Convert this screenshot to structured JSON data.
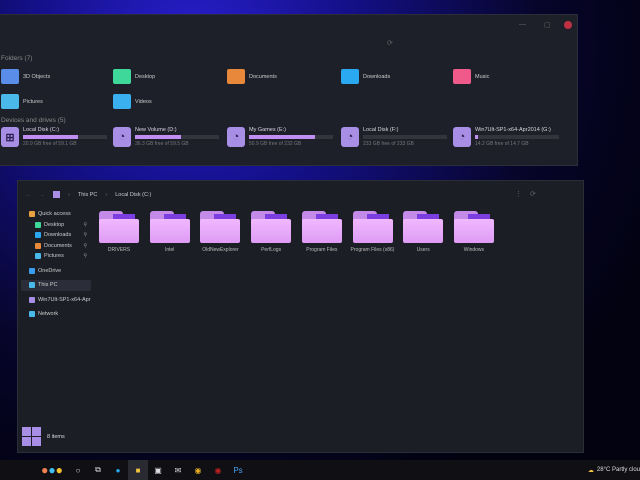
{
  "back_window": {
    "folders_header": "Folders (7)",
    "folders": [
      {
        "label": "3D Objects",
        "icon": "3d-objects-icon",
        "color": "#5a8de8"
      },
      {
        "label": "Desktop",
        "icon": "desktop-icon",
        "color": "#3ed89a"
      },
      {
        "label": "Documents",
        "icon": "documents-icon",
        "color": "#e8883a"
      },
      {
        "label": "Downloads",
        "icon": "downloads-icon",
        "color": "#2aa8f0"
      },
      {
        "label": "Music",
        "icon": "music-icon",
        "color": "#f05a8a"
      },
      {
        "label": "Pictures",
        "icon": "pictures-icon",
        "color": "#4ab8e8"
      },
      {
        "label": "Videos",
        "icon": "videos-icon",
        "color": "#3ab0f0"
      }
    ],
    "drives_header": "Devices and drives (5)",
    "drives": [
      {
        "name": "Local Disk (C:)",
        "free": "20.9 GB free of 59.1 GB",
        "used_fraction": 0.65
      },
      {
        "name": "New Volume (D:)",
        "free": "36.3 GB free of 59.5 GB",
        "used_fraction": 0.55
      },
      {
        "name": "My Games (E:)",
        "free": "50.9 GB free of 232 GB",
        "used_fraction": 0.78
      },
      {
        "name": "Local Disk (F:)",
        "free": "233 GB free of 233 GB",
        "used_fraction": 0
      },
      {
        "name": "Win7Ult-SP1-x64-Apr2014 (G:)",
        "free": "14.2 GB free of 14.7 GB",
        "used_fraction": 0.03
      }
    ]
  },
  "front_window": {
    "breadcrumb": [
      "This PC",
      "Local Disk (C:)"
    ],
    "sidebar": [
      {
        "label": "Quick access",
        "icon": "star-icon",
        "color": "#e8a040",
        "level": 0
      },
      {
        "label": "Desktop",
        "icon": "desktop-icon",
        "color": "#3ed89a",
        "level": 1,
        "pinned": true
      },
      {
        "label": "Downloads",
        "icon": "downloads-icon",
        "color": "#2aa8f0",
        "level": 1,
        "pinned": true
      },
      {
        "label": "Documents",
        "icon": "documents-icon",
        "color": "#e8883a",
        "level": 1,
        "pinned": true
      },
      {
        "label": "Pictures",
        "icon": "pictures-icon",
        "color": "#4ab8e8",
        "level": 1,
        "pinned": true
      },
      {
        "label": "OneDrive",
        "icon": "cloud-icon",
        "color": "#3a9ef0",
        "level": 0
      },
      {
        "label": "This PC",
        "icon": "computer-icon",
        "color": "#4ab8e8",
        "level": 0,
        "selected": true
      },
      {
        "label": "Win7Ult-SP1-x64-Apr",
        "icon": "drive-icon",
        "color": "#a98ee6",
        "level": 0
      },
      {
        "label": "Network",
        "icon": "network-icon",
        "color": "#4ab8e8",
        "level": 0
      }
    ],
    "folders": [
      "DRIVERS",
      "Intel",
      "OldNewExplorer",
      "PerfLogs",
      "Program Files",
      "Program Files (x86)",
      "Users",
      "Windows"
    ],
    "status": "8 items"
  },
  "taskbar": {
    "weather": "28°C  Partly clou",
    "accent": "#a98ee6"
  }
}
